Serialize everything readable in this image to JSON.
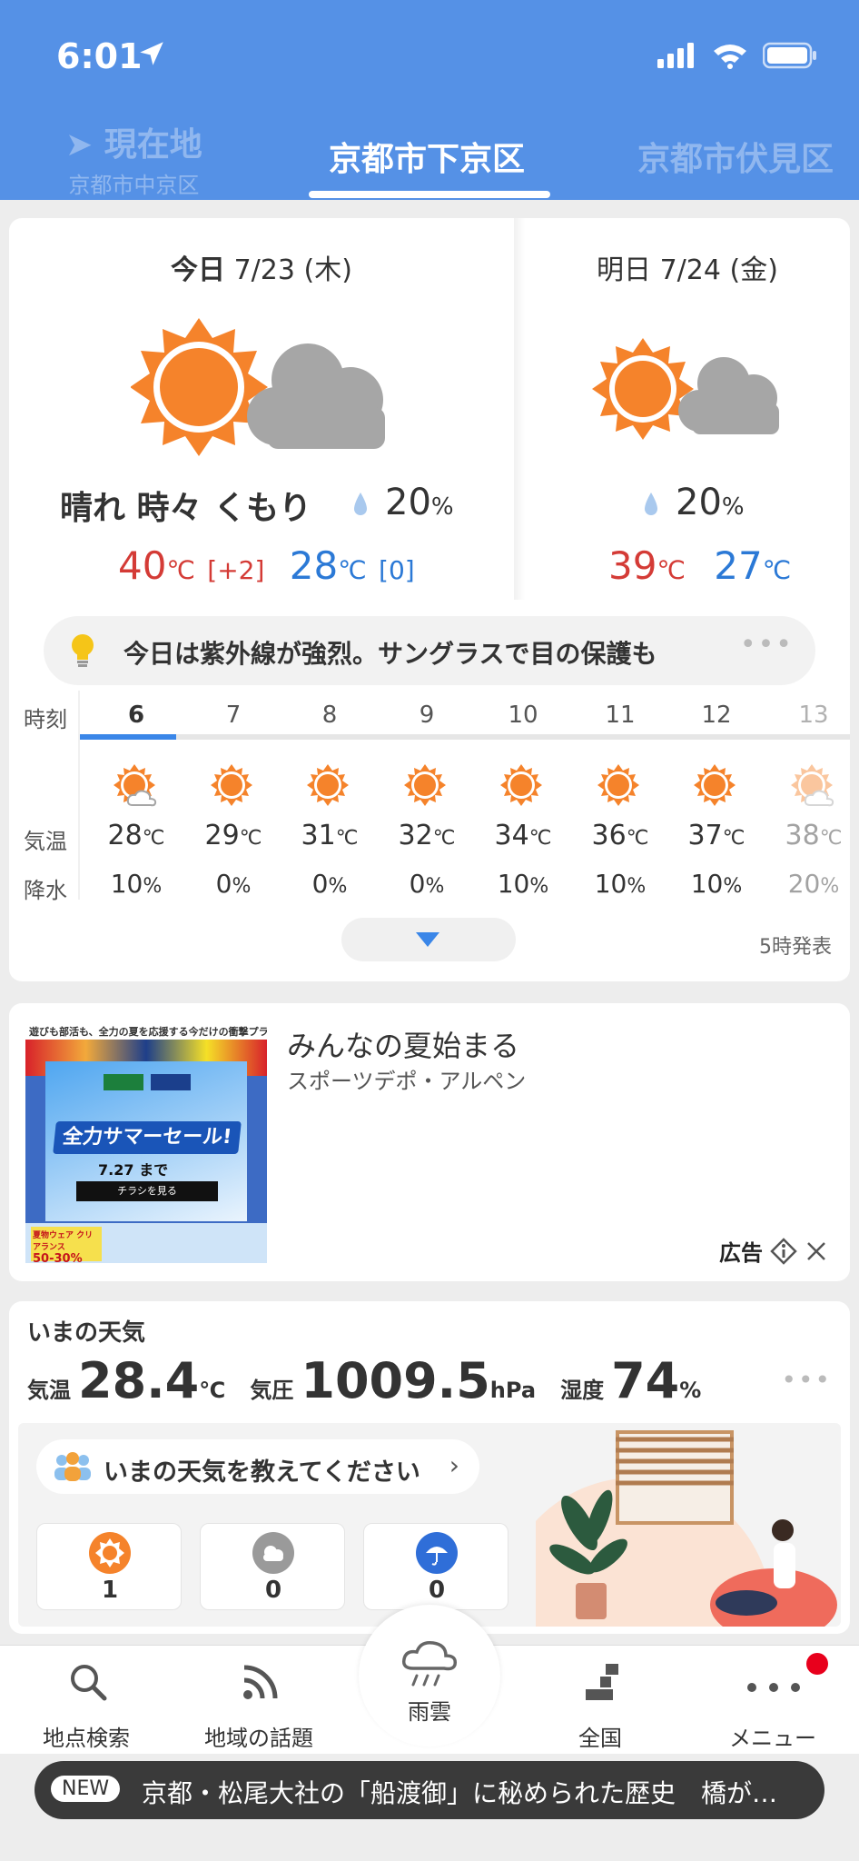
{
  "status": {
    "time": "6:01"
  },
  "tabs": {
    "left_title": "現在地",
    "left_sub": "京都市中京区",
    "center": "京都市下京区",
    "right": "京都市伏見区"
  },
  "today": {
    "label": "今日",
    "date": "7/23",
    "weekday": "(木)",
    "condition": "晴れ 時々 くもり",
    "pop": "20",
    "pop_unit": "%",
    "high": "40",
    "high_diff": "[+2]",
    "low": "28",
    "low_diff": "[0]",
    "unit": "℃"
  },
  "tomorrow": {
    "label": "明日",
    "date": "7/24",
    "weekday": "(金)",
    "pop": "20",
    "pop_unit": "%",
    "high": "39",
    "low": "27",
    "unit": "℃"
  },
  "tip": {
    "text": "今日は紫外線が強烈。サングラスで目の保護も",
    "more": "•••"
  },
  "hourly": {
    "row_labels": {
      "hour": "時刻",
      "temp": "気温",
      "rain": "降水"
    },
    "hours": [
      {
        "hour": "6",
        "temp": "28",
        "rain": "10",
        "icon": "sun-cloud-icon"
      },
      {
        "hour": "7",
        "temp": "29",
        "rain": "0",
        "icon": "sun-icon"
      },
      {
        "hour": "8",
        "temp": "31",
        "rain": "0",
        "icon": "sun-icon"
      },
      {
        "hour": "9",
        "temp": "32",
        "rain": "0",
        "icon": "sun-icon"
      },
      {
        "hour": "10",
        "temp": "34",
        "rain": "10",
        "icon": "sun-icon"
      },
      {
        "hour": "11",
        "temp": "36",
        "rain": "10",
        "icon": "sun-icon"
      },
      {
        "hour": "12",
        "temp": "37",
        "rain": "10",
        "icon": "sun-icon"
      },
      {
        "hour": "13",
        "temp": "38",
        "rain": "20",
        "icon": "sun-cloud-icon"
      }
    ],
    "temp_unit": "℃",
    "rain_unit": "%",
    "issued": "5時発表"
  },
  "ad": {
    "title": "みんなの夏始まる",
    "sponsor": "スポーツデポ・アルペン",
    "label": "広告",
    "banner_top": "遊びも部活も、全力の夏を応援する今だけの衝撃プライス!",
    "banner_sale": "全力サマーセール!",
    "banner_date": "7.27",
    "banner_date_suffix": "まで",
    "banner_flyer": "チラシを見る",
    "banner_clear": "夏物ウェア クリアランス",
    "banner_pct": "50-30%"
  },
  "now": {
    "title": "いまの天気",
    "temp_label": "気温",
    "temp": "28.4",
    "temp_unit": "℃",
    "pressure_label": "気圧",
    "pressure": "1009.5",
    "pressure_unit": "hPa",
    "humidity_label": "湿度",
    "humidity": "74",
    "humidity_unit": "%",
    "ask": "いまの天気を教えてください",
    "votes": [
      {
        "icon": "sun-vote-icon",
        "count": "1"
      },
      {
        "icon": "cloud-vote-icon",
        "count": "0"
      },
      {
        "icon": "rain-vote-icon",
        "count": "0"
      }
    ]
  },
  "tabbar": {
    "search": "地点検索",
    "topics": "地域の話題",
    "rain": "雨雲",
    "national": "全国",
    "menu": "メニュー"
  },
  "news": {
    "tag": "NEW",
    "text": "京都・松尾大社の「船渡御」に秘められた歴史　橋が…"
  },
  "colors": {
    "header": "#5591e6",
    "high": "#d43b36",
    "low": "#2b79d6",
    "accent": "#3a86e8",
    "sun": "#f5832b"
  }
}
